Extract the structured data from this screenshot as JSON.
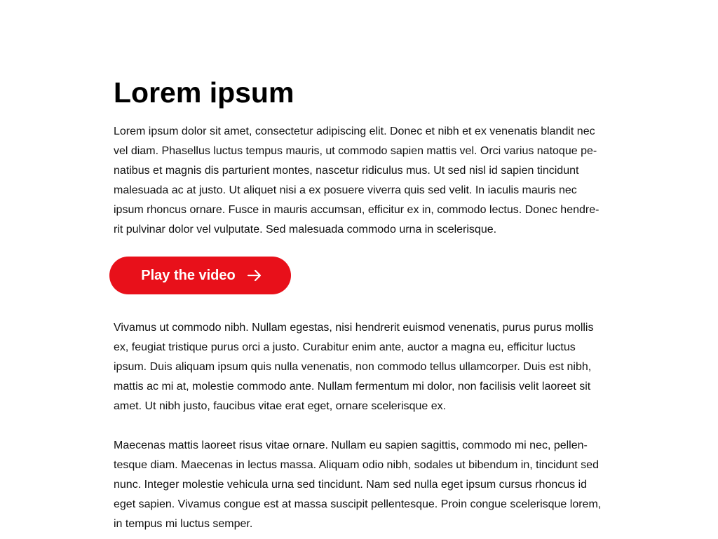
{
  "article": {
    "title": "Lorem ipsum",
    "intro": "Lorem ipsum dolor sit amet, consectetur adipiscing elit. Donec et nibh et ex venenatis blandit nec vel diam. Phasellus luctus tempus mauris, ut commodo sapien mattis vel. Orci varius natoque pe-natibus et magnis dis parturient montes, nascetur ridiculus mus. Ut sed nisl id sapien tincidunt malesuada ac at justo. Ut aliquet nisi a ex posuere viverra quis sed velit. In iaculis mauris nec ipsum rhoncus ornare. Fusce in mauris accumsan, efficitur ex in, commodo lectus. Donec hendre-rit pulvinar dolor vel vulputate. Sed malesuada commodo urna in scelerisque.",
    "cta": {
      "label": "Play the video",
      "icon": "arrow-right-icon",
      "color": "#e8101a",
      "text_color": "#ffffff"
    },
    "body_1": "Vivamus ut commodo nibh. Nullam egestas, nisi hendrerit euismod venenatis, purus purus mollis ex, feugiat tristique purus orci a justo. Curabitur enim ante, auctor a magna eu, efficitur luctus ipsum. Duis aliquam ipsum quis nulla venenatis, non commodo tellus ullamcorper. Duis est nibh, mattis ac mi at, molestie commodo ante. Nullam fermentum mi dolor, non facilisis velit laoreet sit amet. Ut nibh justo, faucibus vitae erat eget, ornare scelerisque ex.",
    "body_2": "Maecenas mattis laoreet risus vitae ornare. Nullam eu sapien sagittis, commodo mi nec, pellen-tesque diam. Maecenas in lectus massa. Aliquam odio nibh, sodales ut bibendum in, tincidunt sed nunc. Integer molestie vehicula urna sed tincidunt. Nam sed nulla eget ipsum cursus rhoncus id eget sapien. Vivamus congue est at massa suscipit pellentesque. Proin congue scelerisque lorem, in tempus mi luctus semper."
  }
}
